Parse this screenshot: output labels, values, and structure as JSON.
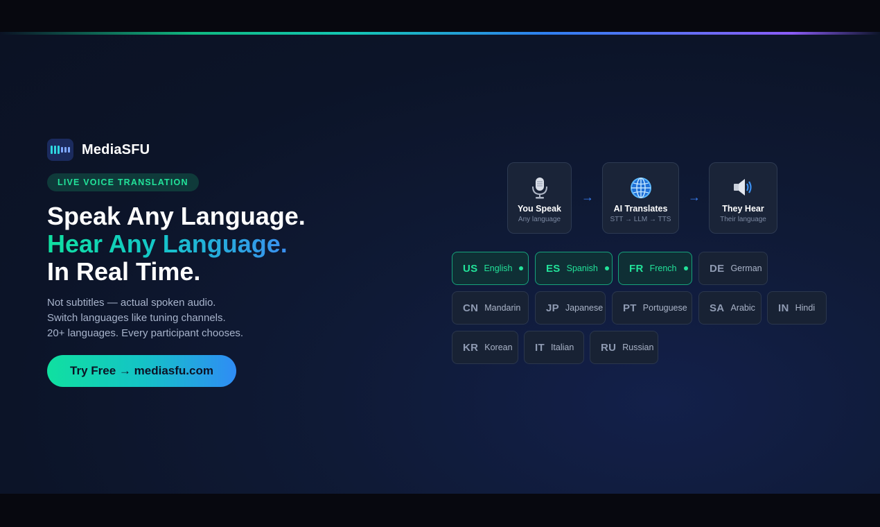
{
  "brand": {
    "name": "MediaSFU"
  },
  "badge": {
    "label": "LIVE VOICE TRANSLATION"
  },
  "headline": {
    "line1": "Speak Any Language.",
    "line2": "Hear Any Language.",
    "line3": "In Real Time."
  },
  "subtext": [
    "Not subtitles — actual spoken audio.",
    "Switch languages like tuning channels.",
    "20+ languages. Every participant chooses."
  ],
  "cta": {
    "label": "Try Free → mediasfu.com"
  },
  "flow": [
    {
      "title": "You Speak",
      "sub": "Any language",
      "icon": "microphone-icon"
    },
    {
      "title": "AI Translates",
      "sub": "STT → LLM → TTS",
      "icon": "globe-icon"
    },
    {
      "title": "They Hear",
      "sub": "Their language",
      "icon": "speaker-icon"
    }
  ],
  "arrows": [
    "→",
    "→"
  ],
  "languages": [
    {
      "code": "US",
      "name": "English",
      "active": true
    },
    {
      "code": "ES",
      "name": "Spanish",
      "active": true
    },
    {
      "code": "FR",
      "name": "French",
      "active": true
    },
    {
      "code": "DE",
      "name": "German",
      "active": false
    },
    {
      "code": "CN",
      "name": "Mandarin",
      "active": false
    },
    {
      "code": "JP",
      "name": "Japanese",
      "active": false
    },
    {
      "code": "PT",
      "name": "Portuguese",
      "active": false
    },
    {
      "code": "SA",
      "name": "Arabic",
      "active": false
    },
    {
      "code": "IN",
      "name": "Hindi",
      "active": false
    },
    {
      "code": "KR",
      "name": "Korean",
      "active": false
    },
    {
      "code": "IT",
      "name": "Italian",
      "active": false
    },
    {
      "code": "RU",
      "name": "Russian",
      "active": false
    }
  ],
  "colors": {
    "accent_green": "#22e39a",
    "accent_blue": "#3b82f6",
    "background": "#0c1428"
  }
}
